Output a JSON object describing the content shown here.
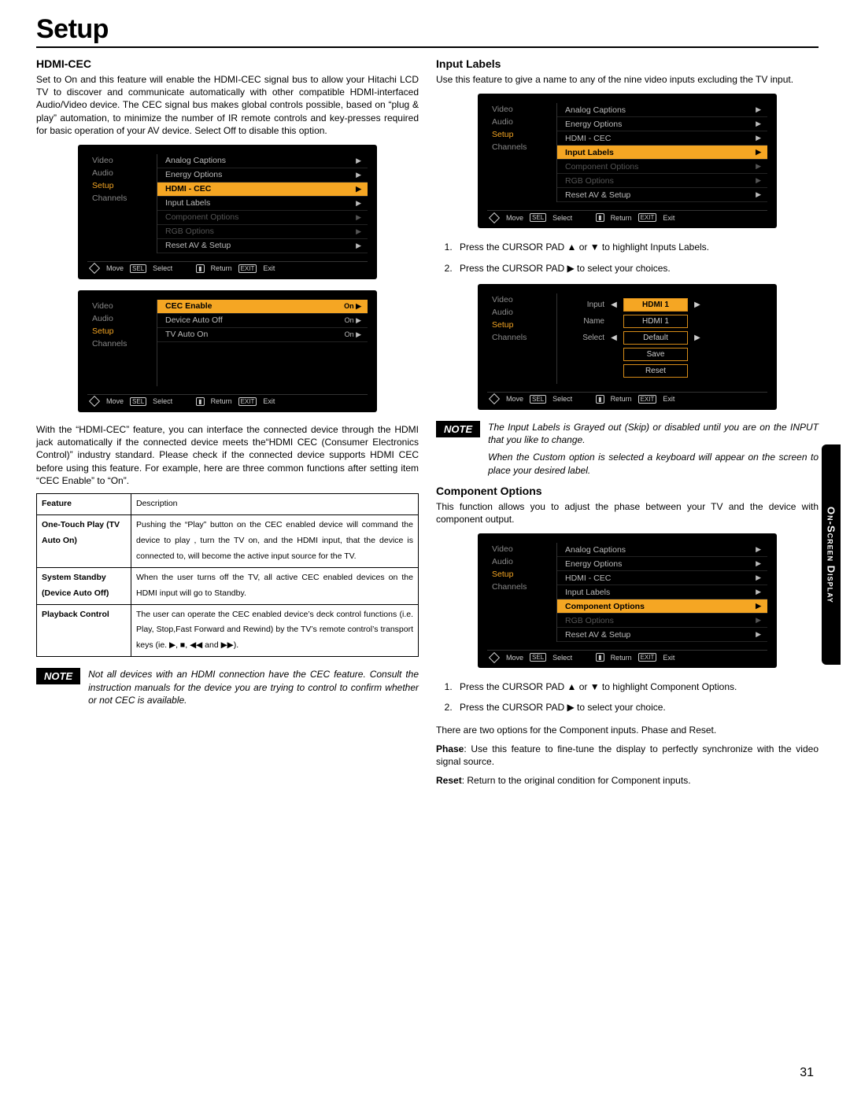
{
  "title": "Setup",
  "spine": "On-Screen Display",
  "pagenum": "31",
  "note_label": "NOTE",
  "osd_nav": {
    "move": "Move",
    "sel_box": "SEL",
    "select": "Select",
    "return": "Return",
    "exit_box": "EXIT",
    "exit": "Exit"
  },
  "left_menu": [
    "Video",
    "Audio",
    "Setup",
    "Channels"
  ],
  "hdmi": {
    "heading": "HDMI-CEC",
    "para1": "Set to On and this feature will enable the HDMI-CEC signal bus to allow your Hitachi LCD TV to discover and communicate automatically with other compatible HDMI-interfaced Audio/Video device. The CEC signal bus makes global controls possible, based on “plug & play” automation, to minimize the number of IR remote controls and key-presses required for basic operation of your AV device. Select Off to disable this option.",
    "menu1": [
      {
        "label": "Analog Captions",
        "dim": false
      },
      {
        "label": "Energy Options",
        "dim": false
      },
      {
        "label": "HDMI - CEC",
        "hl": true
      },
      {
        "label": "Input Labels",
        "dim": false
      },
      {
        "label": "Component Options",
        "dim": true
      },
      {
        "label": "RGB Options",
        "dim": true
      },
      {
        "label": "Reset AV & Setup",
        "dim": false
      }
    ],
    "menu2": [
      {
        "label": "CEC Enable",
        "val": "On ▶",
        "hl": true
      },
      {
        "label": "Device Auto Off",
        "val": "On ▶"
      },
      {
        "label": "TV Auto On",
        "val": "On ▶"
      }
    ],
    "para2": "With the “HDMI-CEC” feature, you can interface the connected device through the HDMI jack automatically if the connected device meets the“HDMI CEC (Consumer Electronics Control)” industry standard. Please check if the connected device supports HDMI CEC before using this feature. For example, here are three common functions after setting item “CEC Enable” to “On”.",
    "table_head": {
      "c1": "Feature",
      "c2": "Description"
    },
    "table": [
      {
        "f": "One-Touch Play (TV Auto On)",
        "d": "Pushing the “Play” button on the CEC enabled device will command the device to play , turn the TV on, and the HDMI input, that the device is connected to, will become the active input source for the TV."
      },
      {
        "f": "System Standby (Device Auto Off)",
        "d": "When the user turns off the TV, all active CEC enabled devices on the HDMI input will go to Standby."
      },
      {
        "f": "Playback Control",
        "d": "The user can operate the CEC enabled device’s deck control functions (i.e. Play, Stop,Fast Forward and Rewind) by the TV’s remote control’s transport keys (ie. ▶, ■, ◀◀ and ▶▶)."
      }
    ],
    "note": "Not all devices with an HDMI connection have the CEC feature. Consult the instruction manuals for the device you are trying to control to confirm whether or not CEC is available."
  },
  "input": {
    "heading": "Input Labels",
    "para": "Use this feature to give a name to any of the nine video inputs excluding the TV input.",
    "menu": [
      {
        "label": "Analog Captions"
      },
      {
        "label": "Energy Options"
      },
      {
        "label": "HDMI - CEC"
      },
      {
        "label": "Input Labels",
        "hl": true
      },
      {
        "label": "Component Options",
        "dim": true
      },
      {
        "label": "RGB Options",
        "dim": true
      },
      {
        "label": "Reset AV & Setup"
      }
    ],
    "steps": [
      "Press the CURSOR PAD ▲ or ▼ to highlight Inputs Labels.",
      "Press the CURSOR PAD ▶ to select your choices."
    ],
    "detail": {
      "rows": [
        {
          "lbl": "Input",
          "left": "◀",
          "val": "HDMI 1",
          "right": "▶",
          "hl": true
        },
        {
          "lbl": "Name",
          "left": "",
          "val": "HDMI 1",
          "right": ""
        },
        {
          "lbl": "Select",
          "left": "◀",
          "val": "Default",
          "right": "▶"
        },
        {
          "lbl": "",
          "left": "",
          "val": "Save",
          "right": ""
        },
        {
          "lbl": "",
          "left": "",
          "val": "Reset",
          "right": ""
        }
      ]
    },
    "note1": "The Input Labels is Grayed out (Skip) or disabled until you are on the INPUT that you like to change.",
    "note2": "When the Custom option is selected a keyboard will appear on the screen to place your desired label."
  },
  "comp": {
    "heading": "Component Options",
    "para1": "This function allows you to adjust the phase between your TV  and the device with component output.",
    "menu": [
      {
        "label": "Analog Captions"
      },
      {
        "label": "Energy Options"
      },
      {
        "label": "HDMI - CEC"
      },
      {
        "label": "Input Labels"
      },
      {
        "label": "Component Options",
        "hl": true
      },
      {
        "label": "RGB Options",
        "dim": true
      },
      {
        "label": "Reset AV & Setup"
      }
    ],
    "steps": [
      "Press the CURSOR PAD ▲ or ▼ to highlight Component Options.",
      "Press the CURSOR PAD  ▶ to select your choice."
    ],
    "para2": "There are two options for the Component inputs. Phase and Reset.",
    "phase_label": "Phase",
    "phase": "Use this feature to fine-tune the display to perfectly synchronize with the video signal source.",
    "reset_label": "Reset",
    "reset": "Return to the  original condition for Component inputs."
  }
}
